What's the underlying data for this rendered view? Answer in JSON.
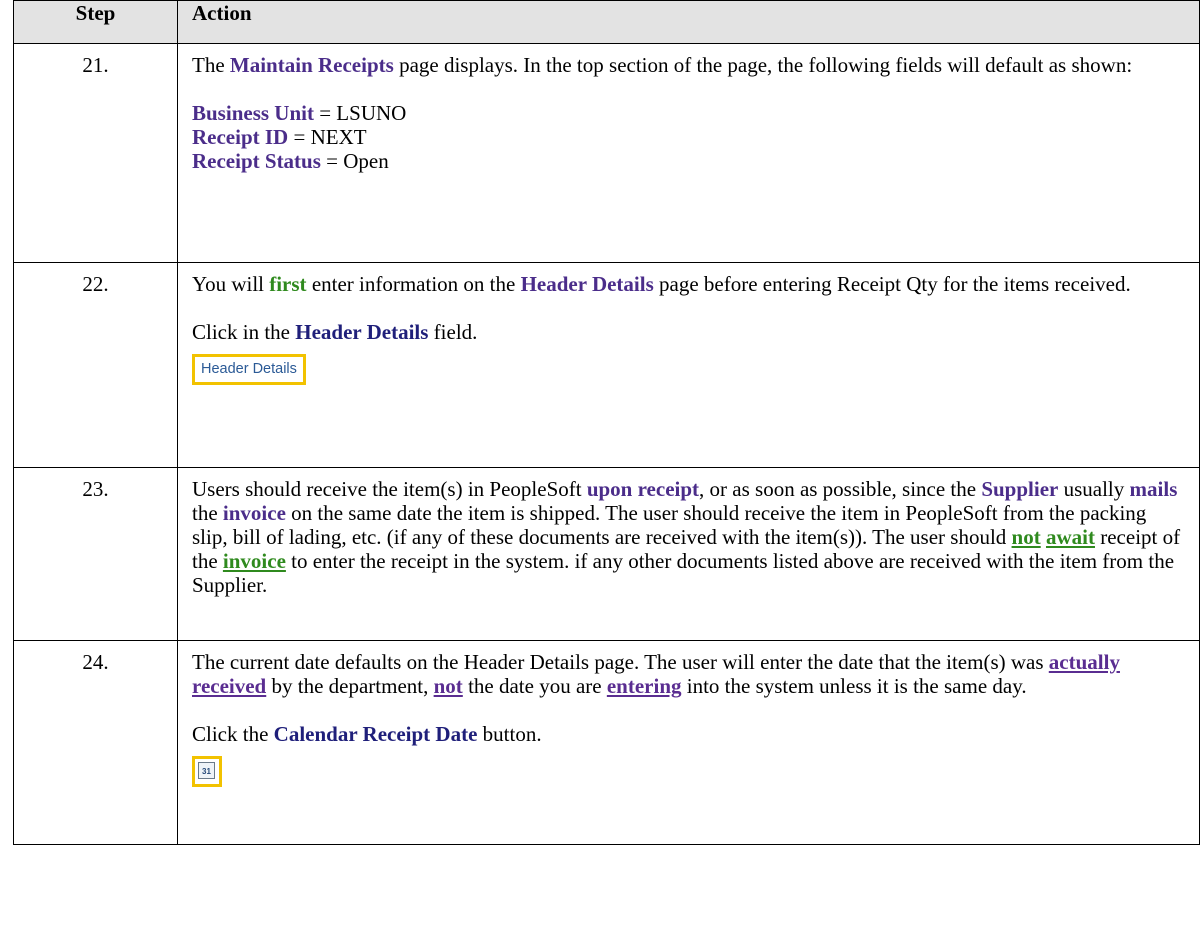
{
  "header": {
    "step": "Step",
    "action": "Action"
  },
  "rows": [
    {
      "num": "21.",
      "intro_a": "The ",
      "intro_b": "Maintain Receipts",
      "intro_c": " page displays. In the top section of the page, the following fields will default as shown:",
      "f1_label": "Business Unit",
      "f1_rest": " = LSUNO",
      "f2_label": "Receipt ID",
      "f2_rest": " = NEXT",
      "f3_label": "Receipt Status",
      "f3_rest": " = Open"
    },
    {
      "num": "22.",
      "p1_a": "You will ",
      "p1_b": "first",
      "p1_c": " enter information on the ",
      "p1_d": "Header Details",
      "p1_e": " page before entering Receipt Qty for the items received.",
      "p2_a": "Click in the ",
      "p2_b": "Header Details",
      "p2_c": " field.",
      "button_label": "Header Details"
    },
    {
      "num": "23.",
      "a": "Users should receive the item(s) in PeopleSoft ",
      "b": "upon receipt",
      "c": ", or as soon as possible, since the ",
      "d": "Supplier",
      "e": " usually ",
      "f": "mails",
      "g": " the ",
      "h": "invoice",
      "i": " on the same date the item is shipped. The user should receive the item in PeopleSoft from the packing slip, bill of lading, etc. (if any of these documents are received with the item(s)). The user should ",
      "j": "not",
      "k": " ",
      "l": "await",
      "m": " receipt of the ",
      "n": "invoice",
      "o": " to enter the receipt in the system. if any other documents listed above are received with the item from the Supplier."
    },
    {
      "num": "24.",
      "a": "The current date defaults on the Header Details page. The user will enter the date that the item(s) was ",
      "b": "actually",
      "c": " ",
      "d": "received",
      "e": " by the department, ",
      "f": "not",
      "g": " the date you are ",
      "h": "entering",
      "i": " into the system unless it is the same day.",
      "p2_a": "Click the ",
      "p2_b": "Calendar Receipt Date",
      "p2_c": " button.",
      "cal_text": "31"
    }
  ]
}
